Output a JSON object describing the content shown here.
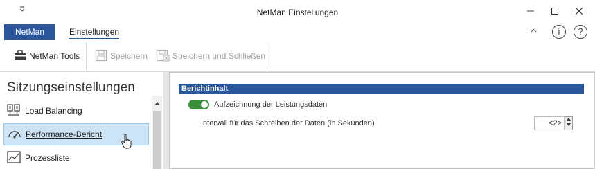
{
  "window": {
    "title": "NetMan Einstellungen",
    "qat_icon": "customize-quick-access-icon",
    "minimize": "–",
    "maximize": "☐",
    "close": "✕"
  },
  "ribbon": {
    "tabs": [
      {
        "label": "NetMan",
        "active": false
      },
      {
        "label": "Einstellungen",
        "active": true
      }
    ],
    "collapse_icon": "˄",
    "info_icon": "i",
    "help_icon": "?",
    "buttons": [
      {
        "label": "NetMan Tools",
        "icon": "toolbox-icon",
        "enabled": true
      },
      {
        "label": "Speichern",
        "icon": "save-icon",
        "enabled": false
      },
      {
        "label": "Speichern und Schließen",
        "icon": "save-close-icon",
        "enabled": false
      }
    ]
  },
  "sidebar": {
    "title": "Sitzungseinstellungen",
    "items": [
      {
        "label": "Load Balancing",
        "icon": "load-balancing-icon",
        "selected": false
      },
      {
        "label": "Performance-Bericht",
        "icon": "gauge-icon",
        "selected": true
      },
      {
        "label": "Prozessliste",
        "icon": "chart-icon",
        "selected": false
      }
    ]
  },
  "main": {
    "section_title": "Berichtinhalt",
    "toggle_label": "Aufzeichnung der Leistungsdaten",
    "toggle_on": true,
    "interval_label": "Intervall für das Schreiben der Daten (in Sekunden)",
    "interval_value": "<2>"
  },
  "colors": {
    "accent": "#2b579a",
    "toggle_on": "#3a8d3a",
    "selection": "#cde4f7"
  }
}
